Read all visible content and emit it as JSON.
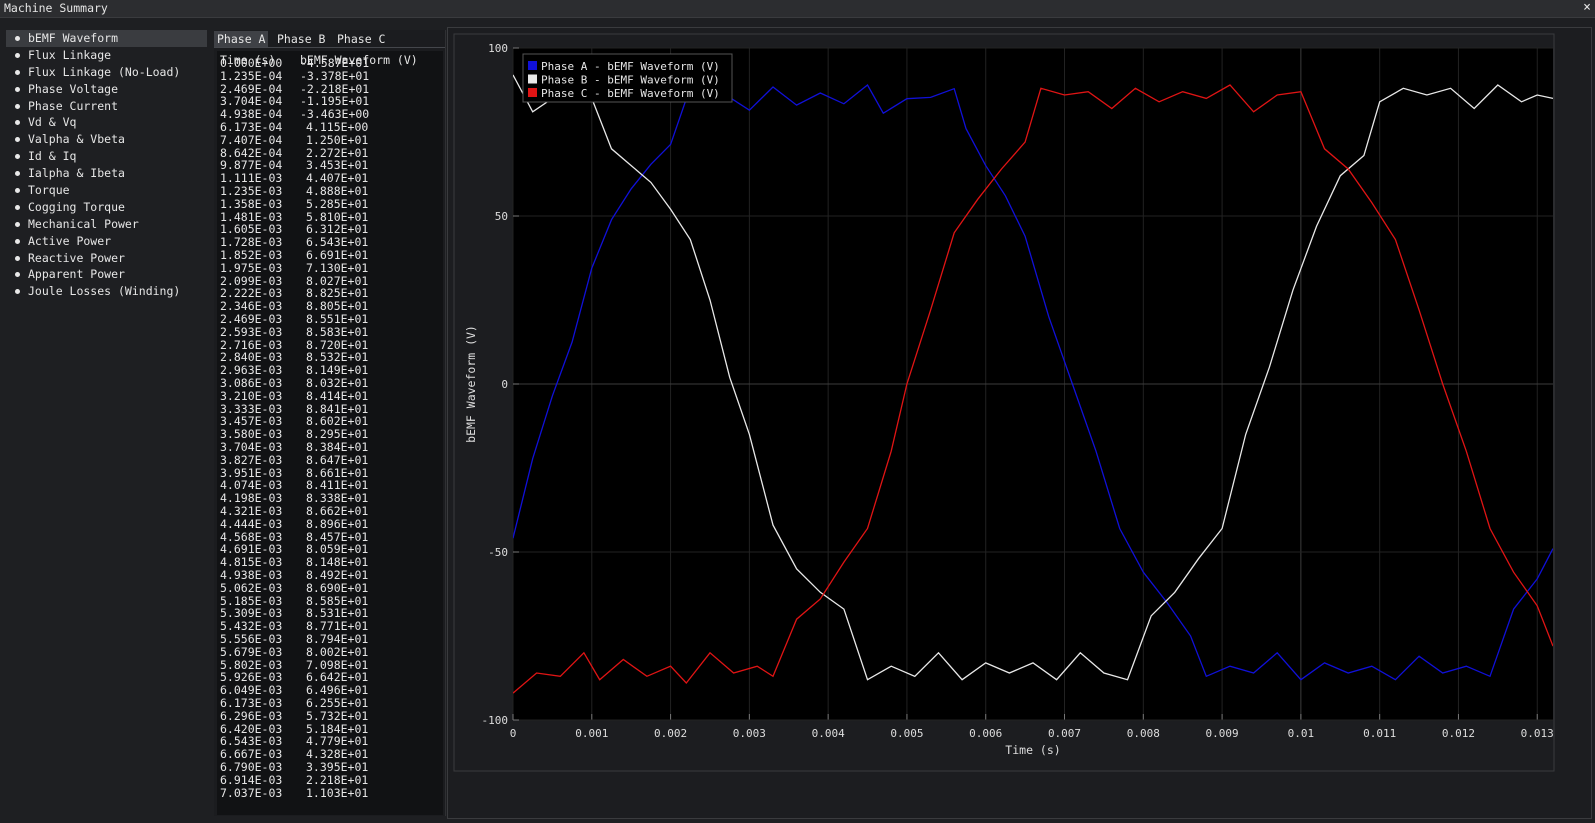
{
  "window": {
    "title": "Machine Summary",
    "close_glyph": "×"
  },
  "sidebar": {
    "items": [
      {
        "label": "bEMF Waveform",
        "active": true
      },
      {
        "label": "Flux Linkage"
      },
      {
        "label": "Flux Linkage (No-Load)"
      },
      {
        "label": "Phase Voltage"
      },
      {
        "label": "Phase Current"
      },
      {
        "label": "Vd & Vq"
      },
      {
        "label": "Valpha & Vbeta"
      },
      {
        "label": "Id & Iq"
      },
      {
        "label": "Ialpha & Ibeta"
      },
      {
        "label": "Torque"
      },
      {
        "label": "Cogging Torque"
      },
      {
        "label": "Mechanical Power"
      },
      {
        "label": "Active Power"
      },
      {
        "label": "Reactive Power"
      },
      {
        "label": "Apparent Power"
      },
      {
        "label": "Joule Losses (Winding)"
      }
    ]
  },
  "tabs": [
    {
      "label": "Phase A",
      "active": true
    },
    {
      "label": "Phase B"
    },
    {
      "label": "Phase C"
    }
  ],
  "table": {
    "headers": [
      "Time (s)",
      "bEMF Waveform (V)"
    ],
    "rows": [
      [
        "0.000E+00",
        "-4.587E+01"
      ],
      [
        "1.235E-04",
        "-3.378E+01"
      ],
      [
        "2.469E-04",
        "-2.218E+01"
      ],
      [
        "3.704E-04",
        "-1.195E+01"
      ],
      [
        "4.938E-04",
        "-3.463E+00"
      ],
      [
        "6.173E-04",
        "4.115E+00"
      ],
      [
        "7.407E-04",
        "1.250E+01"
      ],
      [
        "8.642E-04",
        "2.272E+01"
      ],
      [
        "9.877E-04",
        "3.453E+01"
      ],
      [
        "1.111E-03",
        "4.407E+01"
      ],
      [
        "1.235E-03",
        "4.888E+01"
      ],
      [
        "1.358E-03",
        "5.285E+01"
      ],
      [
        "1.481E-03",
        "5.810E+01"
      ],
      [
        "1.605E-03",
        "6.312E+01"
      ],
      [
        "1.728E-03",
        "6.543E+01"
      ],
      [
        "1.852E-03",
        "6.691E+01"
      ],
      [
        "1.975E-03",
        "7.130E+01"
      ],
      [
        "2.099E-03",
        "8.027E+01"
      ],
      [
        "2.222E-03",
        "8.825E+01"
      ],
      [
        "2.346E-03",
        "8.805E+01"
      ],
      [
        "2.469E-03",
        "8.551E+01"
      ],
      [
        "2.593E-03",
        "8.583E+01"
      ],
      [
        "2.716E-03",
        "8.720E+01"
      ],
      [
        "2.840E-03",
        "8.532E+01"
      ],
      [
        "2.963E-03",
        "8.149E+01"
      ],
      [
        "3.086E-03",
        "8.032E+01"
      ],
      [
        "3.210E-03",
        "8.414E+01"
      ],
      [
        "3.333E-03",
        "8.841E+01"
      ],
      [
        "3.457E-03",
        "8.602E+01"
      ],
      [
        "3.580E-03",
        "8.295E+01"
      ],
      [
        "3.704E-03",
        "8.384E+01"
      ],
      [
        "3.827E-03",
        "8.647E+01"
      ],
      [
        "3.951E-03",
        "8.661E+01"
      ],
      [
        "4.074E-03",
        "8.411E+01"
      ],
      [
        "4.198E-03",
        "8.338E+01"
      ],
      [
        "4.321E-03",
        "8.662E+01"
      ],
      [
        "4.444E-03",
        "8.896E+01"
      ],
      [
        "4.568E-03",
        "8.457E+01"
      ],
      [
        "4.691E-03",
        "8.059E+01"
      ],
      [
        "4.815E-03",
        "8.148E+01"
      ],
      [
        "4.938E-03",
        "8.492E+01"
      ],
      [
        "5.062E-03",
        "8.690E+01"
      ],
      [
        "5.185E-03",
        "8.585E+01"
      ],
      [
        "5.309E-03",
        "8.531E+01"
      ],
      [
        "5.432E-03",
        "8.771E+01"
      ],
      [
        "5.556E-03",
        "8.794E+01"
      ],
      [
        "5.679E-03",
        "8.002E+01"
      ],
      [
        "5.802E-03",
        "7.098E+01"
      ],
      [
        "5.926E-03",
        "6.642E+01"
      ],
      [
        "6.049E-03",
        "6.496E+01"
      ],
      [
        "6.173E-03",
        "6.255E+01"
      ],
      [
        "6.296E-03",
        "5.732E+01"
      ],
      [
        "6.420E-03",
        "5.184E+01"
      ],
      [
        "6.543E-03",
        "4.779E+01"
      ],
      [
        "6.667E-03",
        "4.328E+01"
      ],
      [
        "6.790E-03",
        "3.395E+01"
      ],
      [
        "6.914E-03",
        "2.218E+01"
      ],
      [
        "7.037E-03",
        "1.103E+01"
      ]
    ]
  },
  "chart_data": {
    "type": "line",
    "xlabel": "Time (s)",
    "ylabel": "bEMF Waveform (V)",
    "xlim": [
      0,
      0.0132
    ],
    "ylim": [
      -100,
      100
    ],
    "xticks": [
      0,
      0.001,
      0.002,
      0.003,
      0.004,
      0.005,
      0.006,
      0.007,
      0.008,
      0.009,
      0.01,
      0.011,
      0.012,
      0.013
    ],
    "xtick_labels": [
      "0",
      "0.001",
      "0.002",
      "0.003",
      "0.004",
      "0.005",
      "0.006",
      "0.007",
      "0.008",
      "0.009",
      "0.01",
      "0.011",
      "0.012",
      "0.013"
    ],
    "yticks": [
      -100,
      -50,
      0,
      50,
      100
    ],
    "ytick_labels": [
      "-100",
      "-50",
      "0",
      "50",
      "100"
    ],
    "grid": true,
    "legend_position": "top-left",
    "series": [
      {
        "name": "Phase A - bEMF Waveform (V)",
        "color": "#1010d8",
        "points": [
          [
            0,
            -45.9
          ],
          [
            0.00025,
            -22.2
          ],
          [
            0.0005,
            -3.5
          ],
          [
            0.00075,
            12.5
          ],
          [
            0.001,
            34.5
          ],
          [
            0.00125,
            48.9
          ],
          [
            0.0015,
            58.1
          ],
          [
            0.00175,
            65.4
          ],
          [
            0.002,
            71.3
          ],
          [
            0.00225,
            88.3
          ],
          [
            0.0025,
            85.5
          ],
          [
            0.00275,
            85.3
          ],
          [
            0.003,
            81.5
          ],
          [
            0.0033,
            88.4
          ],
          [
            0.0036,
            83.0
          ],
          [
            0.0039,
            86.6
          ],
          [
            0.0042,
            83.4
          ],
          [
            0.0045,
            89.0
          ],
          [
            0.0047,
            80.6
          ],
          [
            0.005,
            84.9
          ],
          [
            0.0053,
            85.3
          ],
          [
            0.0056,
            87.9
          ],
          [
            0.00575,
            76.0
          ],
          [
            0.006,
            65.0
          ],
          [
            0.00625,
            56.0
          ],
          [
            0.0065,
            44.0
          ],
          [
            0.0068,
            20.0
          ],
          [
            0.0071,
            0.0
          ],
          [
            0.0074,
            -20.0
          ],
          [
            0.0077,
            -43.0
          ],
          [
            0.008,
            -56.0
          ],
          [
            0.0083,
            -65.0
          ],
          [
            0.0086,
            -75.0
          ],
          [
            0.0088,
            -87.0
          ],
          [
            0.0091,
            -84.0
          ],
          [
            0.0094,
            -86.0
          ],
          [
            0.0097,
            -80.0
          ],
          [
            0.01,
            -88.0
          ],
          [
            0.0103,
            -83.0
          ],
          [
            0.0106,
            -86.0
          ],
          [
            0.0109,
            -84.0
          ],
          [
            0.0112,
            -88.0
          ],
          [
            0.0115,
            -81.0
          ],
          [
            0.0118,
            -86.0
          ],
          [
            0.0121,
            -84.0
          ],
          [
            0.0124,
            -87.0
          ],
          [
            0.0127,
            -67.0
          ],
          [
            0.013,
            -58.0
          ],
          [
            0.0132,
            -49.0
          ]
        ]
      },
      {
        "name": "Phase B - bEMF Waveform (V)",
        "color": "#e8e8e8",
        "points": [
          [
            0,
            92.0
          ],
          [
            0.00025,
            81.0
          ],
          [
            0.0005,
            85.0
          ],
          [
            0.00075,
            90.0
          ],
          [
            0.001,
            85.0
          ],
          [
            0.00125,
            70.0
          ],
          [
            0.0015,
            65.0
          ],
          [
            0.00175,
            60.0
          ],
          [
            0.002,
            52.0
          ],
          [
            0.00225,
            43.0
          ],
          [
            0.0025,
            25.0
          ],
          [
            0.00275,
            2.0
          ],
          [
            0.003,
            -15.0
          ],
          [
            0.0033,
            -42.0
          ],
          [
            0.0036,
            -55.0
          ],
          [
            0.0039,
            -62.0
          ],
          [
            0.0042,
            -67.0
          ],
          [
            0.0045,
            -88.0
          ],
          [
            0.0048,
            -84.0
          ],
          [
            0.0051,
            -87.0
          ],
          [
            0.0054,
            -80.0
          ],
          [
            0.0057,
            -88.0
          ],
          [
            0.006,
            -83.0
          ],
          [
            0.0063,
            -86.0
          ],
          [
            0.0066,
            -83.0
          ],
          [
            0.0069,
            -88.0
          ],
          [
            0.0072,
            -80.0
          ],
          [
            0.0075,
            -86.0
          ],
          [
            0.0078,
            -88.0
          ],
          [
            0.0081,
            -69.0
          ],
          [
            0.0084,
            -62.0
          ],
          [
            0.0087,
            -52.0
          ],
          [
            0.009,
            -43.0
          ],
          [
            0.0093,
            -15.0
          ],
          [
            0.0096,
            5.0
          ],
          [
            0.0099,
            28.0
          ],
          [
            0.0102,
            47.0
          ],
          [
            0.0105,
            62.0
          ],
          [
            0.0108,
            68.0
          ],
          [
            0.011,
            84.0
          ],
          [
            0.0113,
            88.0
          ],
          [
            0.0116,
            86.0
          ],
          [
            0.0119,
            88.0
          ],
          [
            0.0122,
            82.0
          ],
          [
            0.0125,
            89.0
          ],
          [
            0.0128,
            84.0
          ],
          [
            0.013,
            86.0
          ],
          [
            0.0132,
            85.0
          ]
        ]
      },
      {
        "name": "Phase C - bEMF Waveform (V)",
        "color": "#e01414",
        "points": [
          [
            0,
            -92.0
          ],
          [
            0.0003,
            -86.0
          ],
          [
            0.0006,
            -87.0
          ],
          [
            0.0009,
            -80.0
          ],
          [
            0.0011,
            -88.0
          ],
          [
            0.0014,
            -82.0
          ],
          [
            0.0017,
            -87.0
          ],
          [
            0.002,
            -84.0
          ],
          [
            0.0022,
            -89.0
          ],
          [
            0.0025,
            -80.0
          ],
          [
            0.0028,
            -86.0
          ],
          [
            0.0031,
            -84.0
          ],
          [
            0.0033,
            -87.0
          ],
          [
            0.0036,
            -70.0
          ],
          [
            0.0039,
            -64.0
          ],
          [
            0.0042,
            -53.0
          ],
          [
            0.0045,
            -43.0
          ],
          [
            0.0048,
            -20.0
          ],
          [
            0.005,
            0.0
          ],
          [
            0.0053,
            22.0
          ],
          [
            0.0056,
            45.0
          ],
          [
            0.0059,
            55.0
          ],
          [
            0.0062,
            64.0
          ],
          [
            0.0065,
            72.0
          ],
          [
            0.0067,
            88.0
          ],
          [
            0.007,
            86.0
          ],
          [
            0.0073,
            87.0
          ],
          [
            0.0076,
            82.0
          ],
          [
            0.0079,
            88.0
          ],
          [
            0.0082,
            84.0
          ],
          [
            0.0085,
            87.0
          ],
          [
            0.0088,
            85.0
          ],
          [
            0.0091,
            89.0
          ],
          [
            0.0094,
            81.0
          ],
          [
            0.0097,
            86.0
          ],
          [
            0.01,
            87.0
          ],
          [
            0.0103,
            70.0
          ],
          [
            0.0106,
            64.0
          ],
          [
            0.0109,
            54.0
          ],
          [
            0.0112,
            43.0
          ],
          [
            0.0115,
            22.0
          ],
          [
            0.0118,
            0.0
          ],
          [
            0.0121,
            -20.0
          ],
          [
            0.0124,
            -43.0
          ],
          [
            0.0127,
            -56.0
          ],
          [
            0.013,
            -66.0
          ],
          [
            0.0132,
            -78.0
          ]
        ]
      }
    ]
  }
}
